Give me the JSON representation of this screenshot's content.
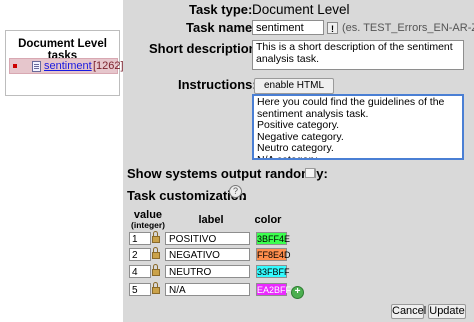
{
  "left": {
    "title": "Document Level tasks",
    "task": {
      "name": "sentiment",
      "count": "[1262]"
    }
  },
  "form": {
    "task_type_label": "Task type:",
    "task_type_value": "Document Level",
    "task_name_label": "Task name:",
    "task_name_value": "sentiment",
    "task_name_hint": "(es. TEST_Errors_EN-AR-ZH)",
    "short_desc_label": "Short description:",
    "short_desc_value": "This is a short description of the sentiment analysis task.",
    "instructions_label": "Instructions:",
    "html_editor_button": "enable HTML editor",
    "instructions_value": "Here you could find the guidelines of the sentiment analysis task.\nPositive category.\nNegative category.\nNeutro category.\nN/A category.",
    "show_output_label": "Show systems output randomly:",
    "customization_label": "Task customization",
    "customization_colon": ":",
    "help_icon_text": "?",
    "mini_button_text": "!",
    "add_button_text": "+"
  },
  "table": {
    "headers": {
      "value": "value",
      "value_sub": "(integer)",
      "label": "label",
      "color": "color"
    },
    "rows": [
      {
        "value": "1",
        "label": "POSITIVO",
        "color": "3BFF4E"
      },
      {
        "value": "2",
        "label": "NEGATIVO",
        "color": "FF8E4D"
      },
      {
        "value": "4",
        "label": "NEUTRO",
        "color": "33FBFF"
      },
      {
        "value": "5",
        "label": "N/A",
        "color": "EA2BFF"
      }
    ]
  },
  "buttons": {
    "cancel": "Cancel",
    "update": "Update"
  },
  "colors": {
    "panel": "#d9d9d9",
    "link": "#1a1ae0",
    "task_highlight": "#e6c6cc"
  }
}
